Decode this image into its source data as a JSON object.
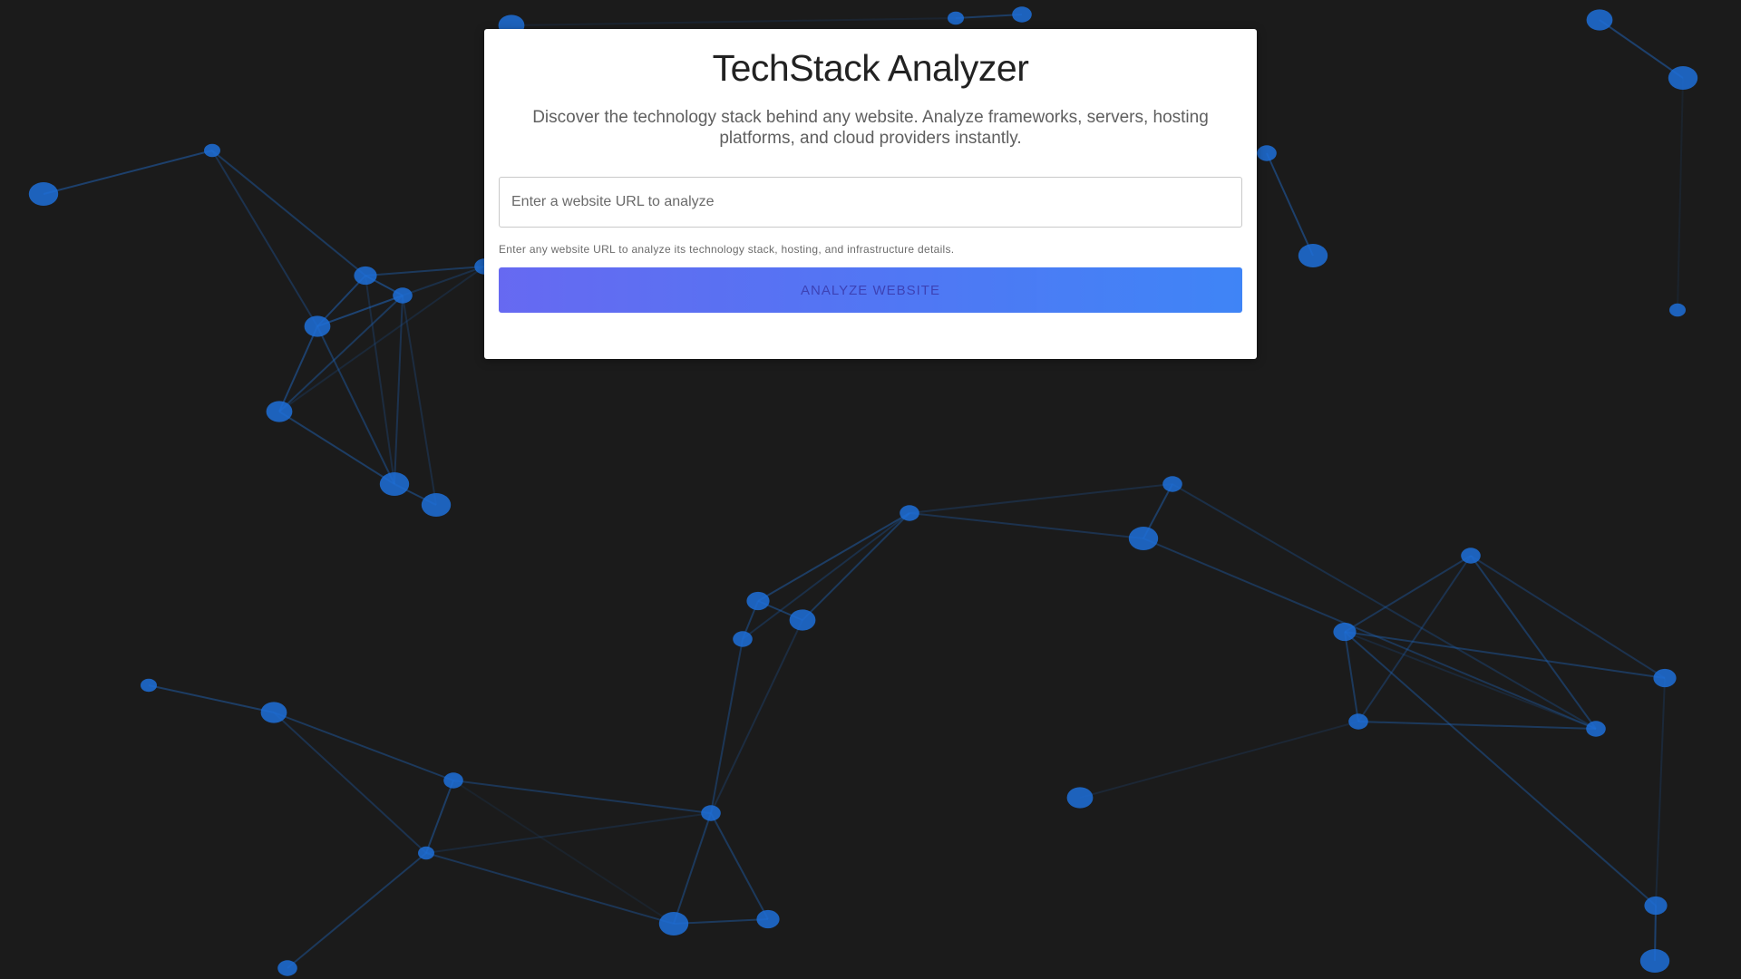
{
  "app": {
    "title": "TechStack Analyzer",
    "subtitle": "Discover the technology stack behind any website. Analyze frameworks, servers, hosting platforms, and cloud providers instantly."
  },
  "form": {
    "url_placeholder": "Enter a website URL to analyze",
    "url_value": "",
    "helper_text": "Enter any website URL to analyze its technology stack, hosting, and infrastructure details.",
    "submit_label": "ANALYZE WEBSITE"
  },
  "colors": {
    "background": "#1b1b1b",
    "node": "#1d6fd8",
    "edge": "#1f5fae",
    "button_gradient_start": "#6366f1",
    "button_gradient_end": "#3b82f6"
  }
}
